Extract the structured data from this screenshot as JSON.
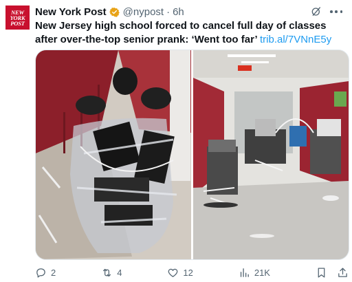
{
  "post": {
    "avatar_text": [
      "NEW",
      "YORK",
      "POST"
    ],
    "display_name": "New York Post",
    "handle": "@nypost",
    "separator": "·",
    "timestamp": "6h",
    "headline": "New Jersey high school forced to cancel full day of classes after over-the-top senior prank: ‘Went too far’",
    "link_text": "trib.al/7VNnE5y"
  },
  "actions": {
    "replies": "2",
    "reposts": "4",
    "likes": "12",
    "views": "21K"
  },
  "colors": {
    "brand": "#c8102e",
    "link": "#1d9bf0",
    "verified": "#e8a317",
    "secondary_text": "#536471"
  },
  "icons": {
    "verified": "verified-badge-icon",
    "grok": "grok-icon",
    "more": "more-icon",
    "reply": "reply-icon",
    "repost": "repost-icon",
    "like": "like-icon",
    "views": "views-icon",
    "bookmark": "bookmark-icon",
    "share": "share-icon"
  }
}
